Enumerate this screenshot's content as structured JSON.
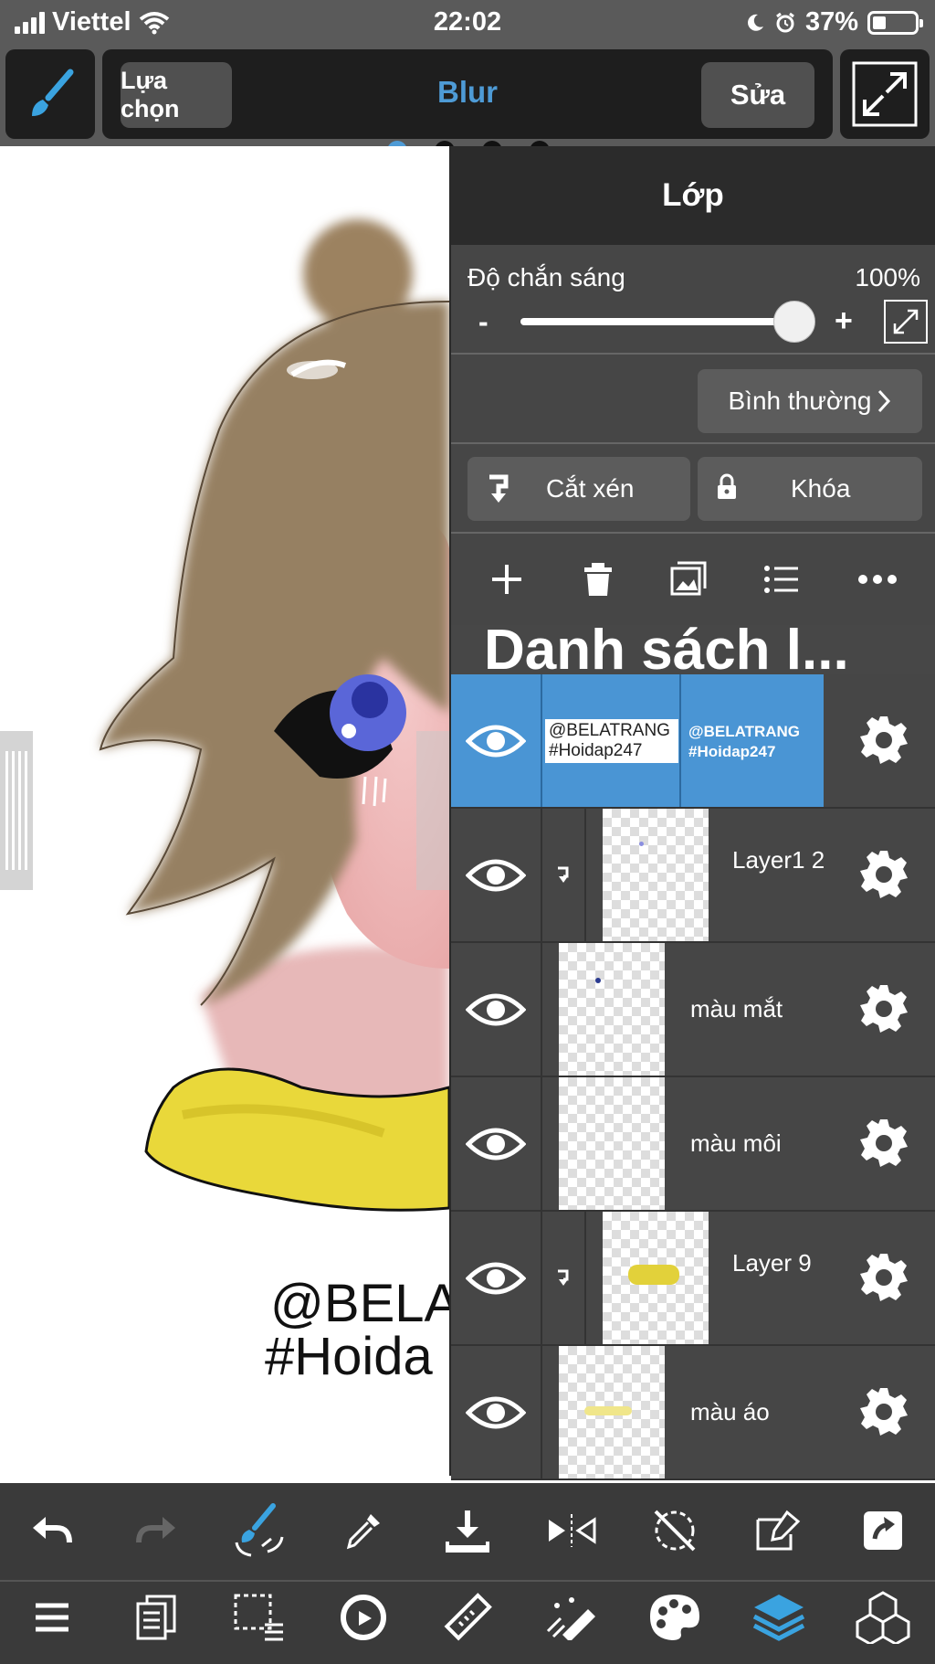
{
  "status_bar": {
    "carrier": "Viettel",
    "time": "22:02",
    "battery": "37%"
  },
  "toolbar": {
    "select_label": "Lựa chọn",
    "tool_title": "Blur",
    "edit_label": "Sửa"
  },
  "layer_panel": {
    "title": "Lớp",
    "opacity_label": "Độ chắn sáng",
    "opacity_value": "100%",
    "opacity_fraction": 1.0,
    "minus": "-",
    "plus": "+",
    "blend_mode": "Bình thường",
    "clipping_label": "Cắt xén",
    "lock_label": "Khóa",
    "list_heading": "Danh sách l...",
    "layers": [
      {
        "name": "@BELATRANG #Hoidap247",
        "thumb_text": "@BELATRANG #Hoidap247",
        "selected": true
      },
      {
        "name": "Layer1 2",
        "clipped": true
      },
      {
        "name": "màu mắt"
      },
      {
        "name": "màu môi"
      },
      {
        "name": "Layer 9",
        "clipped": true
      },
      {
        "name": "màu áo"
      }
    ]
  },
  "canvas": {
    "watermark_line1": "@BELA",
    "watermark_line2": "#Hoida"
  },
  "colors": {
    "accent": "#4e9bd6",
    "selected_layer": "#4a95d4",
    "panel_bg": "#464646"
  }
}
